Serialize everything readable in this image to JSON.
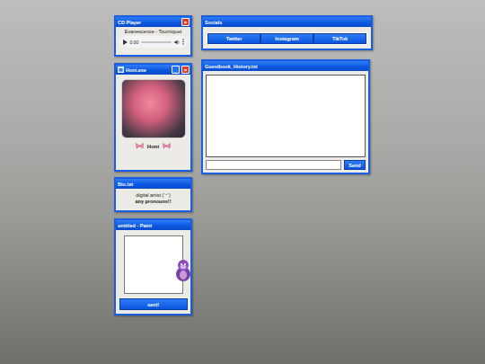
{
  "cd_player": {
    "title": "CD Player",
    "close": "×",
    "track": "Evanescence - Tourniquet",
    "time": "0:00",
    "playing": false,
    "level": 0
  },
  "profile": {
    "title": "Honi.exe",
    "minimize": "_",
    "close": "×",
    "name": "Honi"
  },
  "bio": {
    "title": "Bio.txt",
    "lines": [
      {
        "text": "digital artist (´ᵕ`)",
        "bold": false
      },
      {
        "text": "any pronouns!!",
        "bold": true
      }
    ]
  },
  "paint": {
    "title": "untitled - Paint",
    "button": "sent!"
  },
  "socials": {
    "title": "Socials",
    "links": [
      "Twitter",
      "Instagram",
      "TikTok"
    ]
  },
  "guestbook": {
    "title": "Guestbook_History.txt",
    "history": "",
    "input": "",
    "button": "Send"
  }
}
